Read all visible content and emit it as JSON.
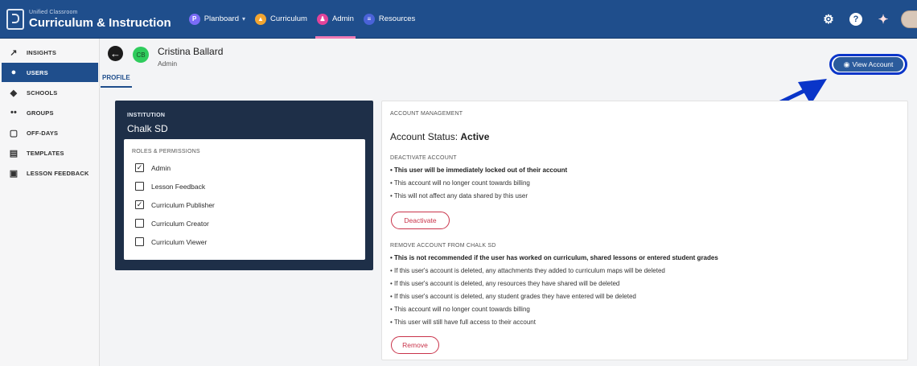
{
  "topbar": {
    "brand_small": "Unified Classroom",
    "brand_big": "Curriculum & Instruction",
    "nav": [
      {
        "label": "Planboard",
        "icon": "planboard-p-icon",
        "color": "#7b6cf6",
        "has_menu": true
      },
      {
        "label": "Curriculum",
        "icon": "curriculum-icon",
        "color": "#f2a531",
        "has_menu": false
      },
      {
        "label": "Admin",
        "icon": "admin-icon",
        "color": "#e2439a",
        "has_menu": false,
        "active": true
      },
      {
        "label": "Resources",
        "icon": "resources-icon",
        "color": "#4a62d8",
        "has_menu": false
      }
    ],
    "right_icons": [
      "gear-icon",
      "help-icon",
      "announcements-icon",
      "user-avatar-icon"
    ]
  },
  "sidebar": {
    "items": [
      {
        "label": "INSIGHTS",
        "icon": "insights-icon",
        "active": false
      },
      {
        "label": "USERS",
        "icon": "users-icon",
        "active": true
      },
      {
        "label": "SCHOOLS",
        "icon": "schools-icon",
        "active": false
      },
      {
        "label": "GROUPS",
        "icon": "groups-icon",
        "active": false
      },
      {
        "label": "OFF-DAYS",
        "icon": "calendar-icon",
        "active": false
      },
      {
        "label": "TEMPLATES",
        "icon": "templates-icon",
        "active": false
      },
      {
        "label": "LESSON FEEDBACK",
        "icon": "feedback-icon",
        "active": false
      }
    ]
  },
  "user": {
    "initials": "CB",
    "name": "Cristina Ballard",
    "role": "Admin",
    "avatar_color": "#2fcc5d"
  },
  "tabs": {
    "profile": "PROFILE"
  },
  "view_account": {
    "label": "View Account"
  },
  "institution": {
    "label": "INSTITUTION",
    "name": "Chalk SD",
    "roles_label": "ROLES & PERMISSIONS",
    "roles": [
      {
        "label": "Admin",
        "checked": true
      },
      {
        "label": "Lesson Feedback",
        "checked": false
      },
      {
        "label": "Curriculum Publisher",
        "checked": true
      },
      {
        "label": "Curriculum Creator",
        "checked": false
      },
      {
        "label": "Curriculum Viewer",
        "checked": false
      }
    ]
  },
  "account": {
    "section_label": "ACCOUNT MANAGEMENT",
    "status_prefix": "Account Status:",
    "status_value": "Active",
    "deactivate": {
      "label": "DEACTIVATE ACCOUNT",
      "bullets": [
        "• This user will be immediately locked out of their account",
        "• This account will no longer count towards billing",
        "• This will not affect any data shared by this user"
      ],
      "button": "Deactivate"
    },
    "remove": {
      "label": "REMOVE ACCOUNT FROM CHALK SD",
      "bullets": [
        "• This is not recommended if the user has worked on curriculum, shared lessons or entered student grades",
        "• If this user's account is deleted, any attachments they added to curriculum maps will be deleted",
        "• If this user's account is deleted, any resources they have shared will be deleted",
        "• If this user's account is deleted, any student grades they have entered will be deleted",
        "• This account will no longer count towards billing",
        "• This user will still have full access to their account"
      ],
      "button": "Remove"
    }
  },
  "colors": {
    "topbar": "#1f4e8c",
    "accent": "#1f4e8c",
    "danger": "#c9334a",
    "annotation": "#0a35c9",
    "institution_card": "#1e2f48"
  }
}
